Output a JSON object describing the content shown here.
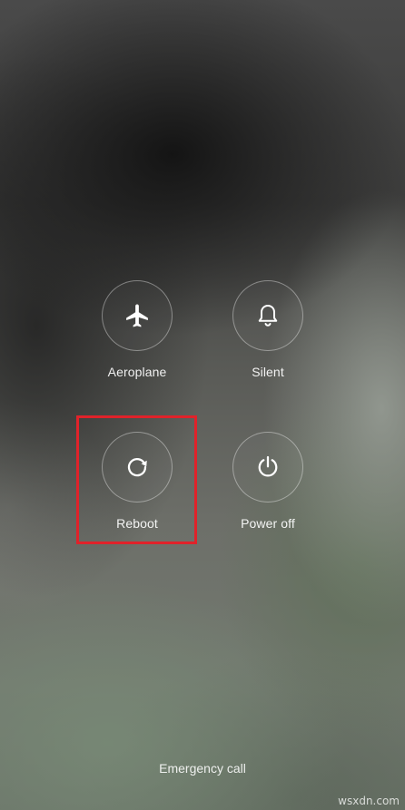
{
  "power_menu": {
    "items": [
      {
        "id": "aeroplane",
        "label": "Aeroplane",
        "icon": "airplane-icon"
      },
      {
        "id": "silent",
        "label": "Silent",
        "icon": "bell-icon"
      },
      {
        "id": "reboot",
        "label": "Reboot",
        "icon": "reboot-icon",
        "highlighted": true
      },
      {
        "id": "power_off",
        "label": "Power off",
        "icon": "power-icon"
      }
    ],
    "emergency_call": "Emergency call"
  },
  "highlight_color": "#e0222a",
  "watermark": "wsxdn.com"
}
